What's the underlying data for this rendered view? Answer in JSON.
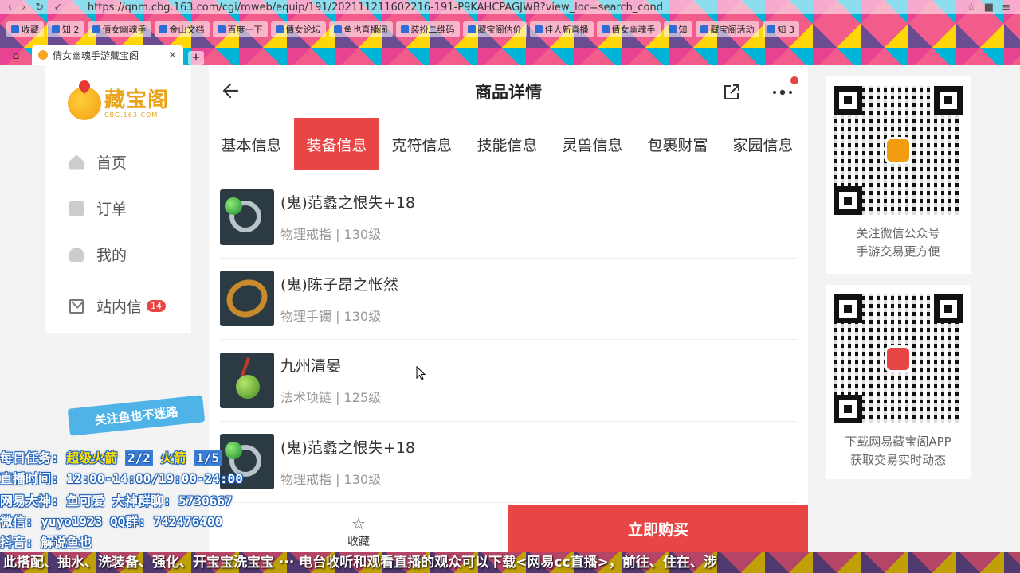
{
  "browser": {
    "url": "https://qnm.cbg.163.com/cgi/mweb/equip/191/202111211602216-191-P9KAHCPAGJWB?view_loc=search_cond",
    "bookmarks": [
      "收藏",
      "知 2",
      "倩女幽魂手",
      "金山文档",
      "百度一下",
      "倩女论坛",
      "鱼也直播间",
      "装扮二维码",
      "藏宝阁估价",
      "佳人新直播",
      "倩女幽魂手",
      "知",
      "藏宝阁活动",
      "知 3"
    ],
    "tab_title": "倩女幽魂手游藏宝阁",
    "new_tab": "+",
    "close": "×"
  },
  "sidebar": {
    "logo_name": "藏宝阁",
    "logo_domain": "CBG.163.COM",
    "items": [
      {
        "label": "首页",
        "icon": "home-icon"
      },
      {
        "label": "订单",
        "icon": "order-icon"
      },
      {
        "label": "我的",
        "icon": "user-icon"
      },
      {
        "label": "站内信",
        "icon": "mail-icon",
        "badge": "14"
      }
    ]
  },
  "main": {
    "title": "商品详情",
    "tabs": [
      "基本信息",
      "装备信息",
      "克符信息",
      "技能信息",
      "灵兽信息",
      "包裹财富",
      "家园信息"
    ],
    "active_tab": 1,
    "items": [
      {
        "name": "(鬼)范蠡之恨失+18",
        "meta": "物理戒指 | 130级",
        "kind": "ring"
      },
      {
        "name": "(鬼)陈子昂之怅然",
        "meta": "物理手镯 | 130级",
        "kind": "bracelet"
      },
      {
        "name": "九州清晏",
        "meta": "法术项链 | 125级",
        "kind": "pendant"
      },
      {
        "name": "(鬼)范蠡之恨失+18",
        "meta": "物理戒指 | 130级",
        "kind": "ring"
      }
    ],
    "fav_label": "收藏",
    "buy_label": "立即购买"
  },
  "qr": {
    "card1_line1": "关注微信公众号",
    "card1_line2": "手游交易更方便",
    "card2_line1": "下载网易藏宝阁APP",
    "card2_line2": "获取交易实时动态"
  },
  "overlay": {
    "banner": "关注鱼也不迷路",
    "task_label": "每日任务:",
    "task_item1": "超级火箭",
    "task_count1": "2/2",
    "task_item2": "火箭",
    "task_count2": "1/5",
    "live_time": "直播时间: 12:00-14:00/19:00-24:00",
    "dashen": "网易大神: 鱼可爱   大神群聊: 5730667",
    "wechat": "微信: yuyo1923   QQ群: 742476400",
    "douyin": "抖音: 解说鱼也",
    "ticker": "此搭配、抽水、洗装备、强化、开宝宝洗宝宝 ··· 电台收听和观看直播的观众可以下载<网易cc直播>，前往、住在、涉"
  },
  "colors": {
    "accent": "#e84545",
    "logo": "#e8a317",
    "overlay_blue": "#4fb3e8"
  }
}
